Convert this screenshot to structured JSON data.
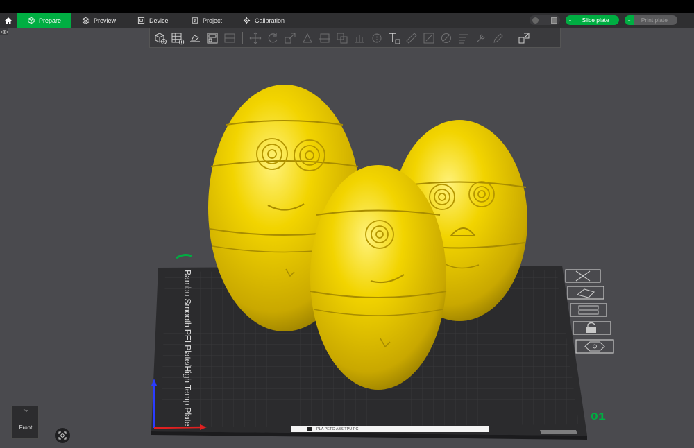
{
  "tabs": [
    {
      "label": "Prepare",
      "icon": "cube-icon",
      "active": true
    },
    {
      "label": "Preview",
      "icon": "layers-icon",
      "active": false
    },
    {
      "label": "Device",
      "icon": "device-icon",
      "active": false
    },
    {
      "label": "Project",
      "icon": "project-icon",
      "active": false
    },
    {
      "label": "Calibration",
      "icon": "calibration-icon",
      "active": false
    }
  ],
  "actions": {
    "slice_label": "Slice plate",
    "print_label": "Print plate"
  },
  "viewport": {
    "plate_type": "Bambu Smooth PEI Plate/High Temp Plate",
    "plate_number": "01",
    "filament_strip": "PLA PETG ABS TPU PC",
    "y_axis_mark": "ℓ",
    "view_top": "Top",
    "view_front": "Front"
  },
  "colors": {
    "accent": "#00ae42",
    "model": "#e6c200",
    "plate": "#2b2b2d",
    "background": "#4a4a4e"
  }
}
